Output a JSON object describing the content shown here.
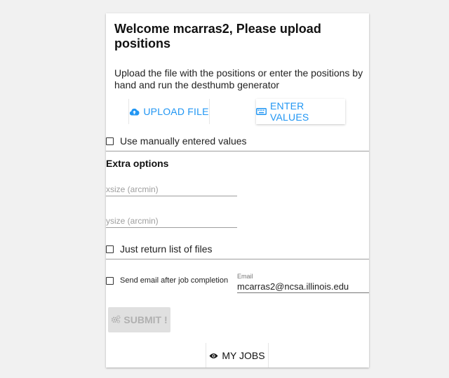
{
  "form": {
    "title": "Welcome mcarras2, Please upload positions",
    "description": "Upload the file with the positions or enter the positions by hand and run the desthumb generator",
    "upload_button": "UPLOAD FILE",
    "enter_values_button": "ENTER VALUES",
    "use_manual_label": "Use manually entered values",
    "extra_options_title": "Extra options",
    "xsize_placeholder": "xsize (arcmin)",
    "ysize_placeholder": "ysize (arcmin)",
    "return_list_label": "Just return list of files",
    "send_email_label": "Send email after job completion",
    "email_label": "Email",
    "email_value": "mcarras2@ncsa.illinois.edu",
    "submit_button": "SUBMIT !",
    "my_jobs_button": "MY JOBS"
  },
  "icons": {
    "upload": "cloud-upload-icon",
    "enter_values": "keyboard-icon",
    "submit": "gears-icon",
    "my_jobs": "eye-icon"
  },
  "colors": {
    "accent": "#2196f3",
    "disabled_bg": "#e0e0e0",
    "disabled_text": "#b0b0b0"
  }
}
